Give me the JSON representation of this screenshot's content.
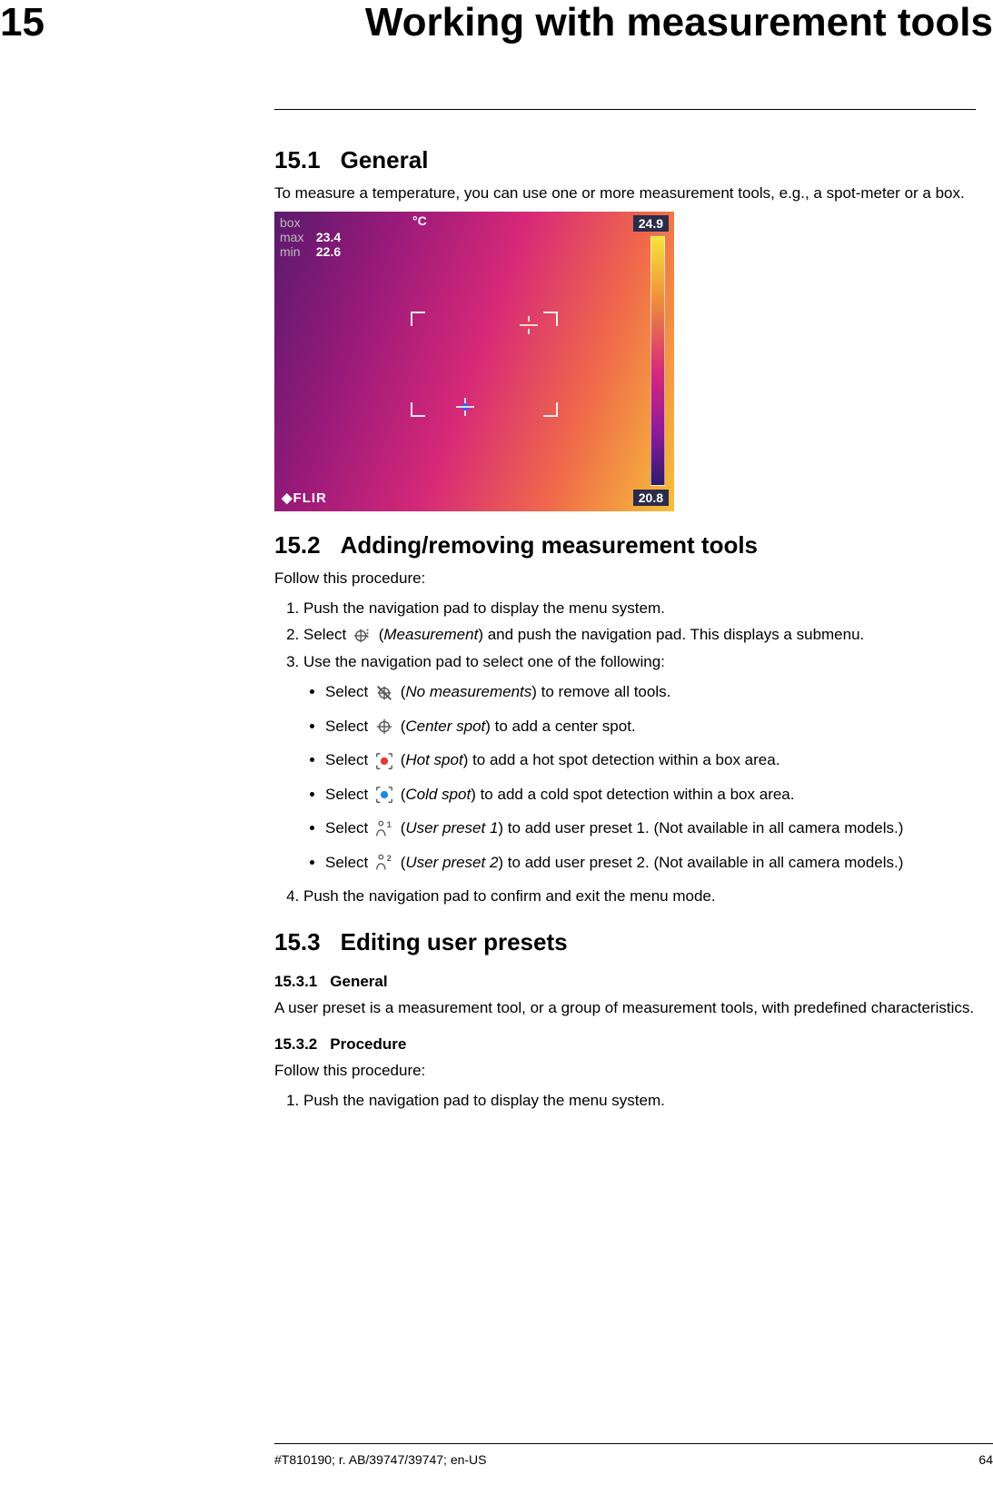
{
  "chapter": {
    "number": "15",
    "title": "Working with measurement tools"
  },
  "s151": {
    "num": "15.1",
    "title": "General",
    "intro": "To measure a temperature, you can use one or more measurement tools, e.g., a spot-meter or a box."
  },
  "thermal": {
    "box_label": "box",
    "max_label": "max",
    "max_val": "23.4",
    "min_label": "min",
    "min_val": "22.6",
    "unit": "°C",
    "scale_top": "24.9",
    "scale_bot": "20.8",
    "brand": "◆FLIR"
  },
  "s152": {
    "num": "15.2",
    "title": "Adding/removing measurement tools",
    "lead": "Follow this procedure:",
    "step1": "Push the navigation pad to display the menu system.",
    "step2_a": "Select ",
    "step2_label": "Measurement",
    "step2_b": ") and push the navigation pad. This displays a submenu.",
    "step3": "Use the navigation pad to select one of the following:",
    "bullets": {
      "b1a": "Select ",
      "b1_label": "No measurements",
      "b1b": ") to remove all tools.",
      "b2a": "Select ",
      "b2_label": "Center spot",
      "b2b": ") to add a center spot.",
      "b3a": "Select ",
      "b3_label": "Hot spot",
      "b3b": ") to add a hot spot detection within a box area.",
      "b4a": "Select ",
      "b4_label": "Cold spot",
      "b4b": ") to add a cold spot detection within a box area.",
      "b5a": "Select ",
      "b5_label": "User preset 1",
      "b5b": ") to add user preset 1. (Not available in all camera models.)",
      "b6a": "Select ",
      "b6_label": "User preset 2",
      "b6b": ") to add user preset 2. (Not available in all camera models.)"
    },
    "step4": "Push the navigation pad to confirm and exit the menu mode."
  },
  "s153": {
    "num": "15.3",
    "title": "Editing user presets",
    "s1531_num": "15.3.1",
    "s1531_title": "General",
    "s1531_body": "A user preset is a measurement tool, or a group of measurement tools, with predefined characteristics.",
    "s1532_num": "15.3.2",
    "s1532_title": "Procedure",
    "s1532_lead": "Follow this procedure:",
    "s1532_step1": "Push the navigation pad to display the menu system."
  },
  "footer": {
    "left": "#T810190; r. AB/39747/39747; en-US",
    "page": "64"
  }
}
